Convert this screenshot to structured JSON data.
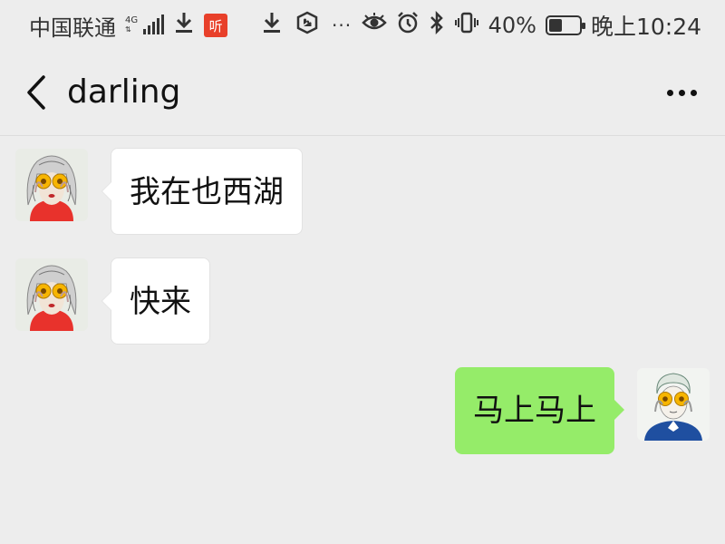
{
  "status_bar": {
    "carrier": "中国联通",
    "network_type": "4G",
    "app_badge": "听",
    "battery_percent": "40%",
    "battery_level": 0.4,
    "time": "晚上10:24",
    "icons": [
      "signal-icon",
      "download-icon",
      "app-badge-icon",
      "download-icon",
      "shield-icon",
      "more-dots-icon",
      "eye-icon",
      "alarm-icon",
      "bluetooth-icon",
      "vibrate-icon",
      "battery-icon"
    ]
  },
  "header": {
    "title": "darling",
    "back_icon": "chevron-left-icon",
    "more_icon": "more-horizontal-icon"
  },
  "messages": [
    {
      "direction": "incoming",
      "text": "我在也西湖",
      "avatar": "contact-avatar"
    },
    {
      "direction": "incoming",
      "text": "快来",
      "avatar": "contact-avatar"
    },
    {
      "direction": "outgoing",
      "text": "马上马上",
      "avatar": "self-avatar"
    }
  ],
  "colors": {
    "background": "#ededed",
    "incoming_bubble": "#ffffff",
    "outgoing_bubble": "#95ec69",
    "app_badge": "#e8402a"
  }
}
